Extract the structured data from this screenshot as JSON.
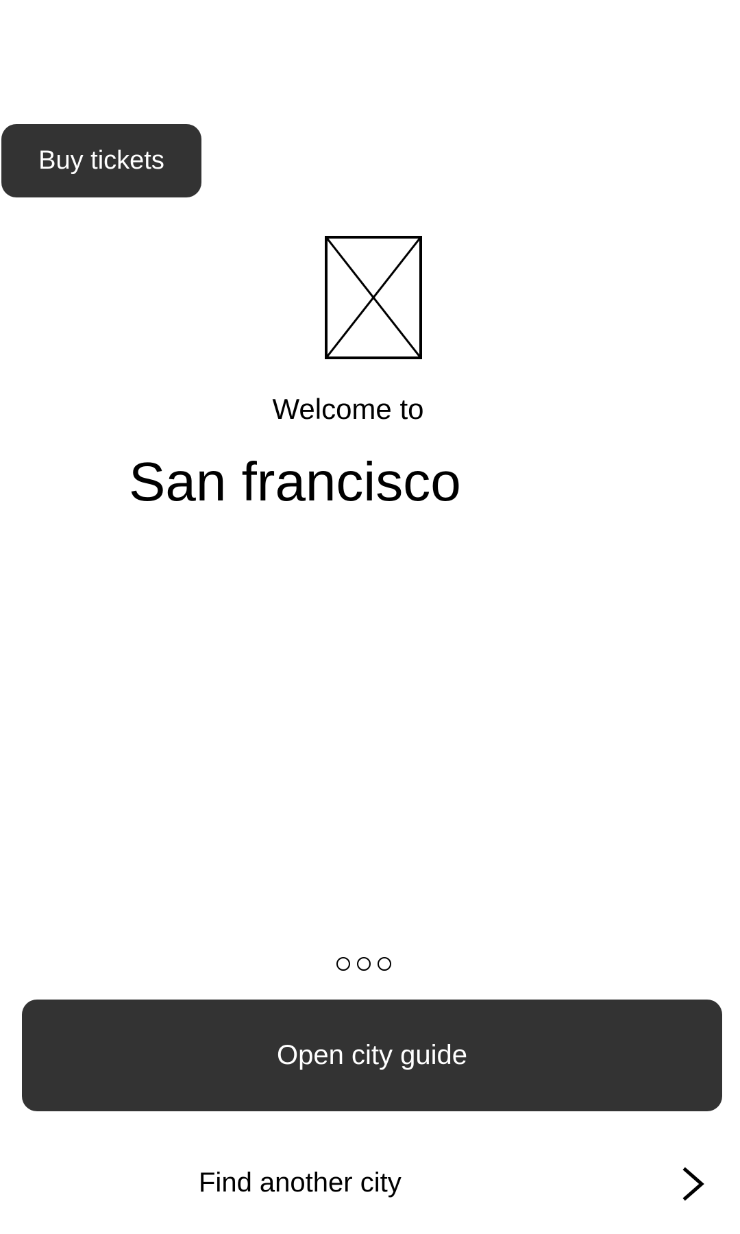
{
  "header": {
    "buy_tickets_label": "Buy tickets"
  },
  "hero": {
    "image_icon": "image-placeholder-icon",
    "welcome_text": "Welcome to",
    "city_name": "San francisco"
  },
  "pager": {
    "dots": 3,
    "icon": "circle-outline-icon"
  },
  "actions": {
    "open_guide_label": "Open city guide",
    "find_city_label": "Find another city",
    "find_city_icon": "chevron-right-icon"
  },
  "colors": {
    "button_background": "#333333",
    "button_text": "#ffffff",
    "text": "#000000",
    "background": "#ffffff"
  }
}
